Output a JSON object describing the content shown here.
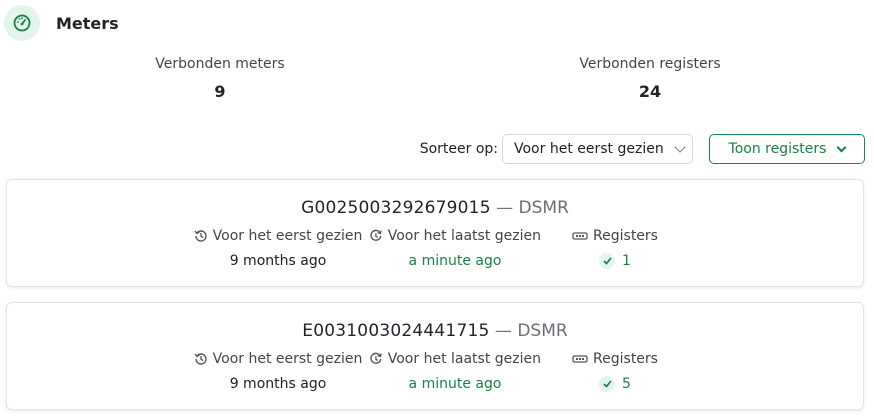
{
  "header": {
    "title": "Meters",
    "icon": "gauge-icon",
    "accent": "#1a7f45",
    "icon_bg": "#e3f4ea"
  },
  "stats": {
    "meters_label": "Verbonden meters",
    "meters_value": "9",
    "registers_label": "Verbonden registers",
    "registers_value": "24"
  },
  "controls": {
    "sort_label": "Sorteer op:",
    "sort_value": "Voor het eerst gezien",
    "toggle_label": "Toon registers"
  },
  "meters": [
    {
      "id": "G0025003292679015",
      "separator": " — ",
      "type": "DSMR",
      "first_seen_label": "Voor het eerst gezien",
      "first_seen": "9 months ago",
      "last_seen_label": "Voor het laatst gezien",
      "last_seen": "a minute ago",
      "registers_label": "Registers",
      "registers": "1"
    },
    {
      "id": "E0031003024441715",
      "separator": " — ",
      "type": "DSMR",
      "first_seen_label": "Voor het eerst gezien",
      "first_seen": "9 months ago",
      "last_seen_label": "Voor het laatst gezien",
      "last_seen": "a minute ago",
      "registers_label": "Registers",
      "registers": "5"
    }
  ]
}
